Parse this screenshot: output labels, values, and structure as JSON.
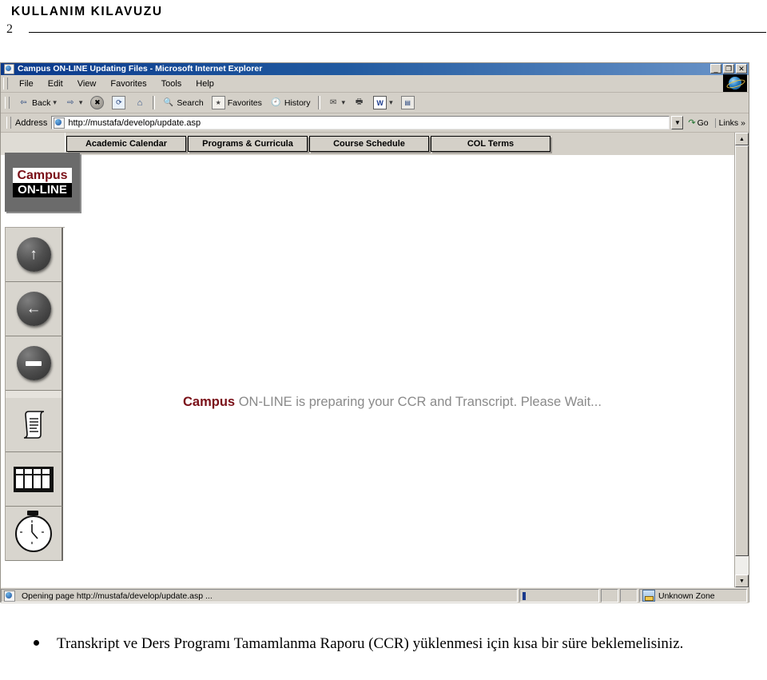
{
  "document": {
    "header_title": "KULLANIM KILAVUZU",
    "page_number": "2",
    "bullet_text": "Transkript ve Ders Programı Tamamlanma Raporu (CCR) yüklenmesi için kısa bir süre beklemelisiniz."
  },
  "browser": {
    "title": "Campus ON-LINE Updating Files - Microsoft Internet Explorer",
    "window_controls": {
      "minimize": "_",
      "restore": "❐",
      "close": "✕"
    },
    "menu": [
      "File",
      "Edit",
      "View",
      "Favorites",
      "Tools",
      "Help"
    ],
    "toolbar": {
      "back": "Back",
      "forward": "",
      "stop": "",
      "refresh": "",
      "home": "",
      "search": "Search",
      "favorites": "Favorites",
      "history": "History",
      "mail": "",
      "print": "",
      "edit": "W"
    },
    "address": {
      "label": "Address",
      "value": "http://mustafa/develop/update.asp",
      "go_label": "Go",
      "links_label": "Links",
      "links_chevron": "»"
    },
    "status": {
      "message": "Opening page http://mustafa/develop/update.asp ...",
      "zone": "Unknown Zone"
    }
  },
  "page": {
    "tabs": [
      {
        "label": "Academic Calendar"
      },
      {
        "label": "Programs & Curricula"
      },
      {
        "label": "Course Schedule"
      },
      {
        "label": "COL Terms"
      }
    ],
    "logo": {
      "top": "Campus",
      "bottom": "ON-LINE"
    },
    "nav_buttons": [
      {
        "name": "up-arrow-button",
        "glyph": "↑"
      },
      {
        "name": "left-arrow-button",
        "glyph": "←"
      },
      {
        "name": "minus-button",
        "glyph": "–"
      },
      {
        "name": "transcript-button",
        "glyph": "scroll"
      },
      {
        "name": "schedule-grid-button",
        "glyph": "grid"
      },
      {
        "name": "clock-button",
        "glyph": "clock"
      }
    ],
    "message": {
      "brand": "Campus",
      "rest": " ON-LINE is preparing your CCR and Transcript. Please Wait..."
    }
  },
  "colors": {
    "brand_red": "#7a1018",
    "chrome_gray": "#d4d0c8",
    "title_blue": "#0b3a8c",
    "message_gray": "#8a8a8a"
  }
}
